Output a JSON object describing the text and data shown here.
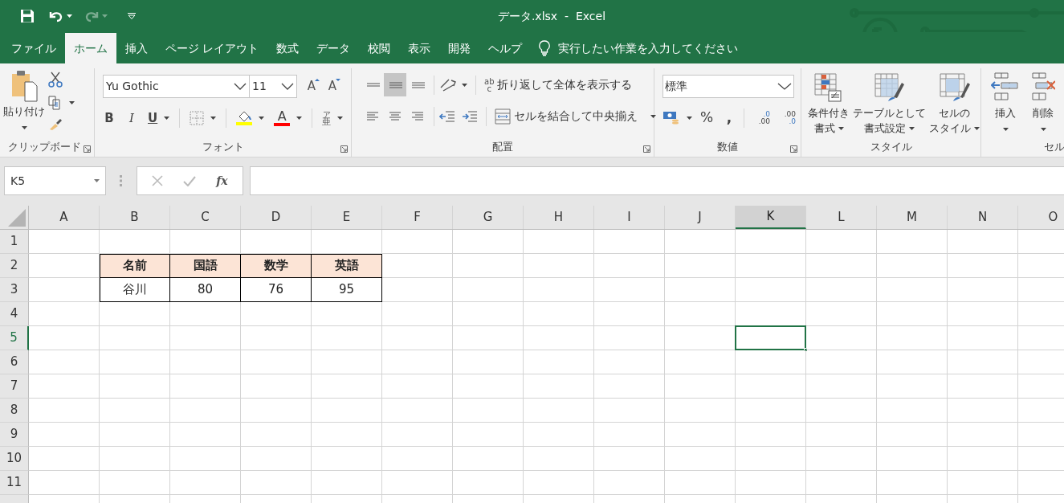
{
  "quick_access": {
    "redo_disabled": true
  },
  "title": "データ.xlsx  -  Excel",
  "tabs": [
    {
      "label": "ファイル",
      "selected": false
    },
    {
      "label": "ホーム",
      "selected": true
    },
    {
      "label": "挿入",
      "selected": false
    },
    {
      "label": "ページ レイアウト",
      "selected": false
    },
    {
      "label": "数式",
      "selected": false
    },
    {
      "label": "データ",
      "selected": false
    },
    {
      "label": "校閲",
      "selected": false
    },
    {
      "label": "表示",
      "selected": false
    },
    {
      "label": "開発",
      "selected": false
    },
    {
      "label": "ヘルプ",
      "selected": false
    }
  ],
  "tell_me": "実行したい作業を入力してください",
  "clipboard": {
    "paste": "貼り付け",
    "group": "クリップボード"
  },
  "font": {
    "name": "Yu Gothic",
    "size": "11",
    "grow": "A",
    "shrink": "A",
    "bold": "B",
    "italic": "I",
    "underline": "U",
    "font_color_letter": "A",
    "phonetic_top": "ア",
    "phonetic_bottom": "亜",
    "group": "フォント"
  },
  "alignment": {
    "vertical": [
      {
        "kind": "top",
        "selected": false
      },
      {
        "kind": "middle",
        "selected": true
      },
      {
        "kind": "bottom",
        "selected": false
      }
    ],
    "wrap_icon_top": "ab",
    "wrap_icon_bottom": "c",
    "wrap": "折り返して全体を表示する",
    "merge": "セルを結合して中央揃え",
    "group": "配置"
  },
  "number": {
    "format": "標準",
    "percent": "%",
    "comma": ",",
    "increase_decimal": [
      ".0",
      ".00"
    ],
    "decrease_decimal": [
      ".00",
      ".0"
    ],
    "group": "数値"
  },
  "styles": {
    "buttons": [
      {
        "kind": "conditional",
        "lines": [
          "条件付き",
          "書式"
        ]
      },
      {
        "kind": "table",
        "lines": [
          "テーブルとして",
          "書式設定"
        ]
      },
      {
        "kind": "cell",
        "lines": [
          "セルの",
          "スタイル"
        ]
      }
    ],
    "group": "スタイル"
  },
  "cells": {
    "buttons": [
      {
        "kind": "insert",
        "label": "挿入"
      },
      {
        "kind": "delete",
        "label": "削除"
      }
    ],
    "group": "セル"
  },
  "name_box": "K5",
  "fx": "fx",
  "sheet": {
    "columns": [
      {
        "label": "A",
        "selected": false
      },
      {
        "label": "B",
        "selected": false
      },
      {
        "label": "C",
        "selected": false
      },
      {
        "label": "D",
        "selected": false
      },
      {
        "label": "E",
        "selected": false
      },
      {
        "label": "F",
        "selected": false
      },
      {
        "label": "G",
        "selected": false
      },
      {
        "label": "H",
        "selected": false
      },
      {
        "label": "I",
        "selected": false
      },
      {
        "label": "J",
        "selected": false
      },
      {
        "label": "K",
        "selected": true
      },
      {
        "label": "L",
        "selected": false
      },
      {
        "label": "M",
        "selected": false
      },
      {
        "label": "N",
        "selected": false
      },
      {
        "label": "O",
        "selected": false
      }
    ],
    "rows": [
      {
        "label": "1",
        "selected": false
      },
      {
        "label": "2",
        "selected": false
      },
      {
        "label": "3",
        "selected": false
      },
      {
        "label": "4",
        "selected": false
      },
      {
        "label": "5",
        "selected": true
      },
      {
        "label": "6",
        "selected": false
      },
      {
        "label": "7",
        "selected": false
      },
      {
        "label": "8",
        "selected": false
      },
      {
        "label": "9",
        "selected": false
      },
      {
        "label": "10",
        "selected": false
      },
      {
        "label": "11",
        "selected": false
      }
    ],
    "table": {
      "header": [
        "名前",
        "国語",
        "数学",
        "英語"
      ],
      "rows": [
        [
          "谷川",
          "80",
          "76",
          "95"
        ]
      ]
    }
  }
}
